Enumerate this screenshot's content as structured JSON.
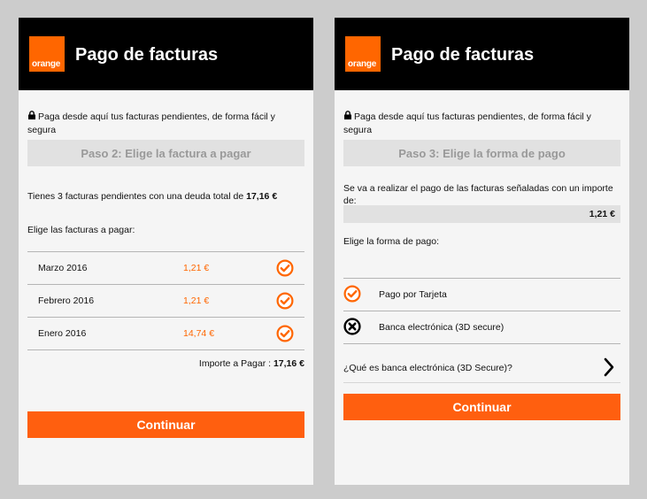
{
  "brand": {
    "logo_text": "orange",
    "accent": "#ff6600"
  },
  "screens": [
    {
      "header_title": "Pago de facturas",
      "intro": "Paga desde aquí tus facturas pendientes, de forma fácil y segura",
      "step": "Paso 2: Elige la factura a pagar",
      "summary_prefix": "Tienes 3 facturas pendientes con una deuda total de ",
      "summary_total": "17,16 €",
      "choose_label": "Elige las facturas a pagar:",
      "invoices": [
        {
          "month": "Marzo 2016",
          "amount": "1,21 €",
          "selected": true
        },
        {
          "month": "Febrero 2016",
          "amount": "1,21 €",
          "selected": true
        },
        {
          "month": "Enero 2016",
          "amount": "14,74 €",
          "selected": true
        }
      ],
      "importe_label": "Importe a Pagar : ",
      "importe_value": "17,16 €",
      "continue_label": "Continuar"
    },
    {
      "header_title": "Pago de facturas",
      "intro": "Paga desde aquí tus facturas pendientes, de forma fácil y segura",
      "step": "Paso 3: Elige la forma de pago",
      "payment_info": "Se va a realizar el pago de las facturas señaladas con un importe de:",
      "payment_amount": "1,21 €",
      "choose_method_label": "Elige la forma de pago:",
      "methods": [
        {
          "label": "Pago por Tarjeta",
          "state": "selected"
        },
        {
          "label": "Banca electrónica (3D secure)",
          "state": "unavailable"
        }
      ],
      "help_link": "¿Qué es banca electrónica (3D Secure)?",
      "continue_label": "Continuar"
    }
  ]
}
